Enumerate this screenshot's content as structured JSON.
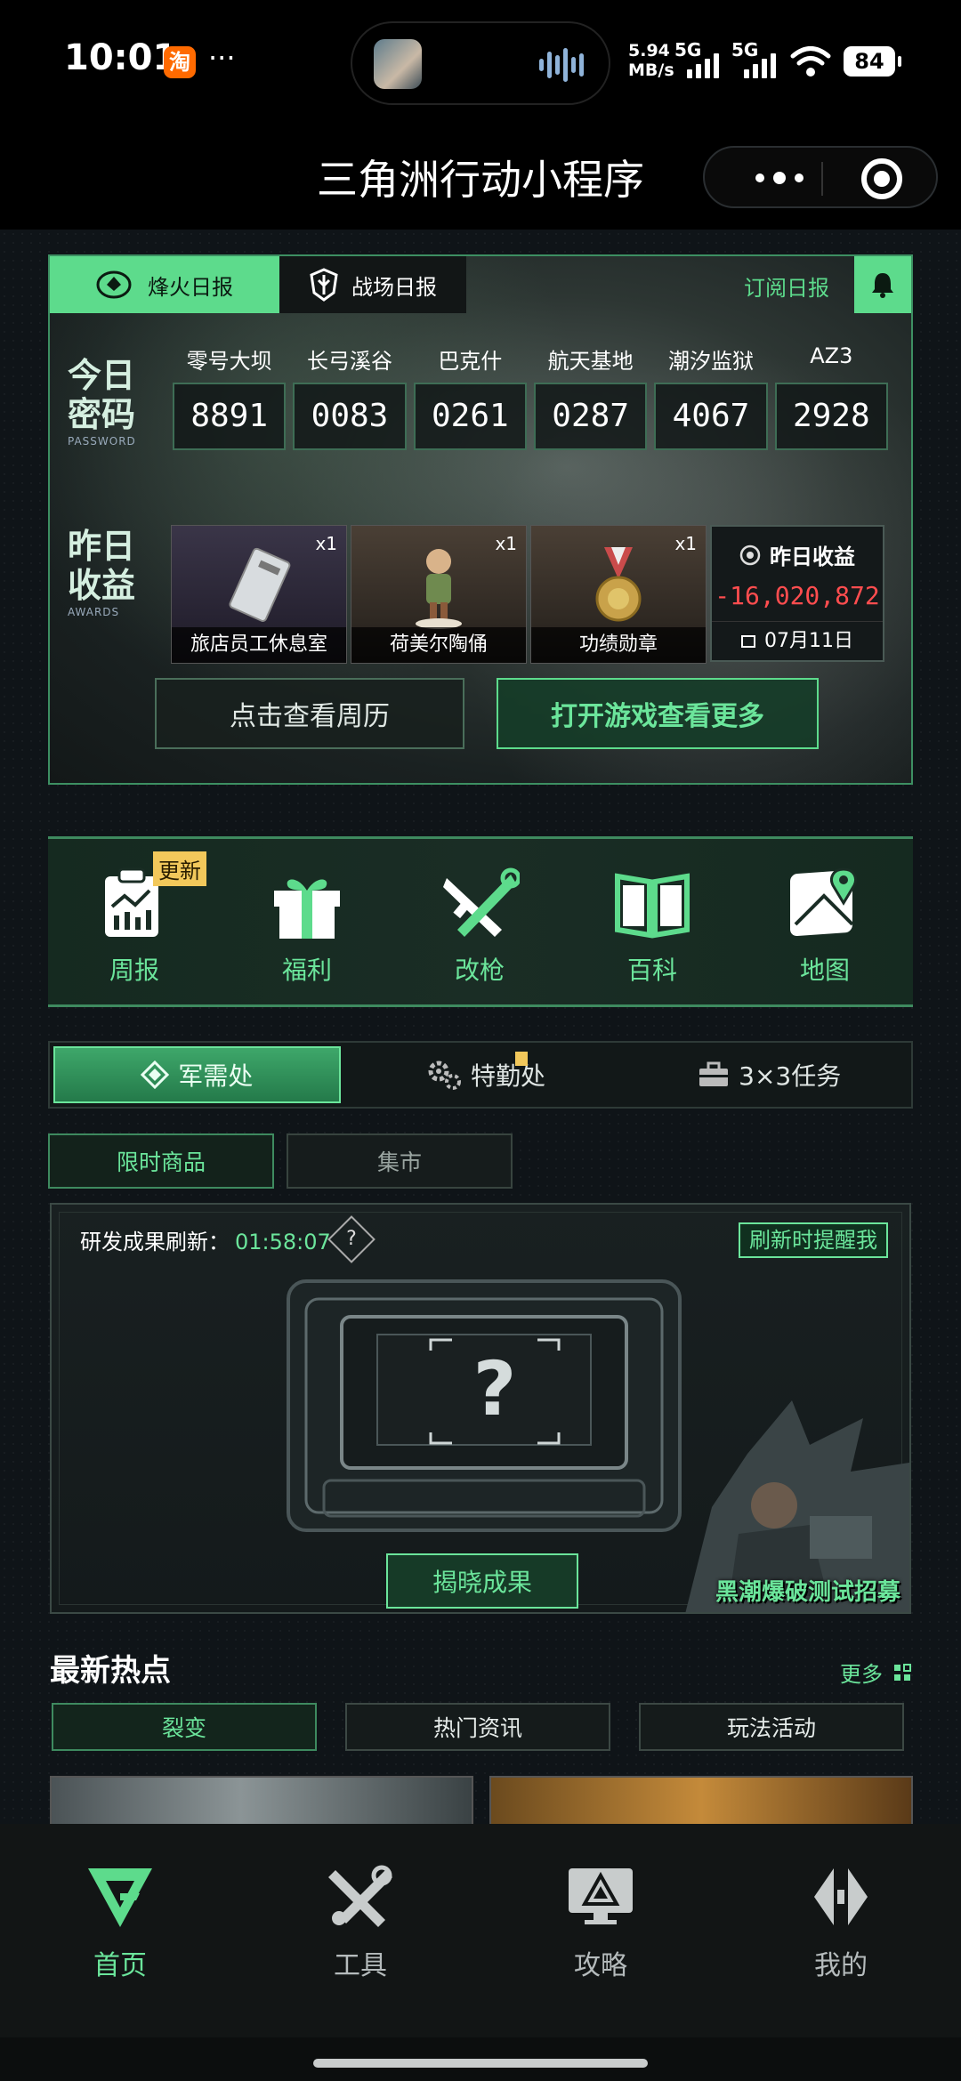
{
  "status_bar": {
    "time": "10:01",
    "app_badge": "淘",
    "more": "···",
    "net_speed": "5.94",
    "net_unit": "MB/s",
    "sim1": "5G",
    "sim2": "5G",
    "battery": "84"
  },
  "header": {
    "title": "三角洲行动小程序"
  },
  "report": {
    "tab_active": "烽火日报",
    "tab_other": "战场日报",
    "subscribe": "订阅日报",
    "password_label_1": "今日",
    "password_label_2": "密码",
    "password_label_en": "PASSWORD",
    "maps": [
      {
        "name": "零号大坝",
        "code": "8891"
      },
      {
        "name": "长弓溪谷",
        "code": "0083"
      },
      {
        "name": "巴克什",
        "code": "0261"
      },
      {
        "name": "航天基地",
        "code": "0287"
      },
      {
        "name": "潮汐监狱",
        "code": "4067"
      },
      {
        "name": "AZ3",
        "code": "2928"
      }
    ],
    "awards_label_1": "昨日",
    "awards_label_2": "收益",
    "awards_label_en": "AWARDS",
    "rewards": [
      {
        "name": "旅店员工休息室",
        "count": "x1"
      },
      {
        "name": "荷美尔陶俑",
        "count": "x1"
      },
      {
        "name": "功绩勋章",
        "count": "x1"
      }
    ],
    "earnings_title": "昨日收益",
    "earnings_value": "-16,020,872",
    "earnings_date": "07月11日",
    "btn_calendar": "点击查看周历",
    "btn_open_game": "打开游戏查看更多"
  },
  "features": [
    {
      "label": "周报",
      "icon": "weekly-report-icon",
      "badge": "更新"
    },
    {
      "label": "福利",
      "icon": "gift-icon"
    },
    {
      "label": "改枪",
      "icon": "gun-wrench-icon"
    },
    {
      "label": "百科",
      "icon": "book-icon"
    },
    {
      "label": "地图",
      "icon": "map-pin-icon"
    }
  ],
  "section_tabs": [
    {
      "label": "军需处",
      "icon": "supply-icon"
    },
    {
      "label": "特勤处",
      "icon": "gear-icon"
    },
    {
      "label": "3×3任务",
      "icon": "briefcase-icon"
    }
  ],
  "sub_tabs": [
    "限时商品",
    "集市"
  ],
  "research": {
    "label": "研发成果刷新：",
    "countdown": "01:58:07",
    "help": "?",
    "remind": "刷新时提醒我",
    "crate_mark": "?",
    "reveal": "揭晓成果",
    "promo": "黑潮爆破测试招募"
  },
  "hot": {
    "title": "最新热点",
    "more": "更多",
    "tabs": [
      "裂变",
      "热门资讯",
      "玩法活动"
    ]
  },
  "bottom_nav": [
    {
      "label": "首页",
      "icon": "home-icon"
    },
    {
      "label": "工具",
      "icon": "tools-icon"
    },
    {
      "label": "攻略",
      "icon": "guide-icon"
    },
    {
      "label": "我的",
      "icon": "profile-icon"
    }
  ],
  "colors": {
    "accent": "#6be59b",
    "accent_dark": "#3e8a5f",
    "negative": "#ff4d4f",
    "badge": "#f2c85b"
  }
}
